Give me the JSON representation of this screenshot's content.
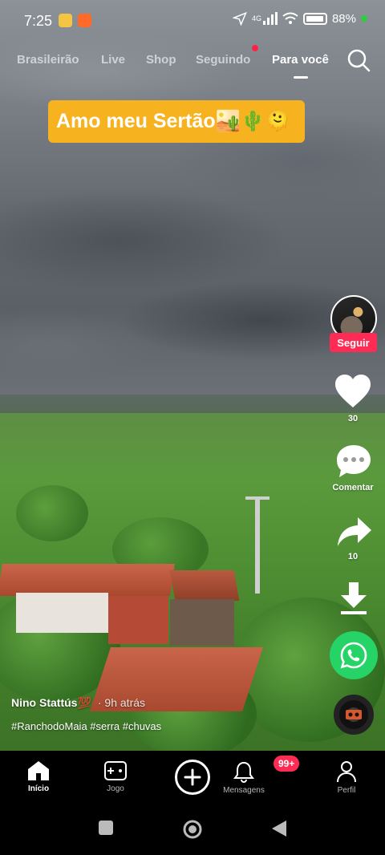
{
  "status_bar": {
    "time": "7:25",
    "network": "4G",
    "battery": "88%"
  },
  "tabs": [
    {
      "label": "Brasileirão",
      "active": false
    },
    {
      "label": "Live",
      "active": false
    },
    {
      "label": "Shop",
      "active": false
    },
    {
      "label": "Seguindo",
      "active": false,
      "notification_dot": true
    },
    {
      "label": "Para você",
      "active": true
    }
  ],
  "sticker": {
    "text": "Amo meu Sertão🏜️🌵🫠"
  },
  "rail": {
    "follow_label": "Seguir",
    "like_count": "30",
    "comment_label": "Comentar",
    "share_count": "10"
  },
  "caption": {
    "author": "Nino Stattús💯",
    "time_ago": "· 9h atrás",
    "hashtags": "#RanchodoMaia #serra #chuvas"
  },
  "bottom_nav": {
    "items": [
      {
        "label": "Início",
        "active": true
      },
      {
        "label": "Jogo",
        "active": false
      },
      {
        "label": "",
        "active": false
      },
      {
        "label": "Mensagens",
        "active": false
      },
      {
        "label": "Perfil",
        "active": false
      }
    ],
    "messages_badge": "99+"
  },
  "colors": {
    "accent": "#fe2c55",
    "sticker_bg": "#f7b21f",
    "whatsapp": "#25d366"
  }
}
